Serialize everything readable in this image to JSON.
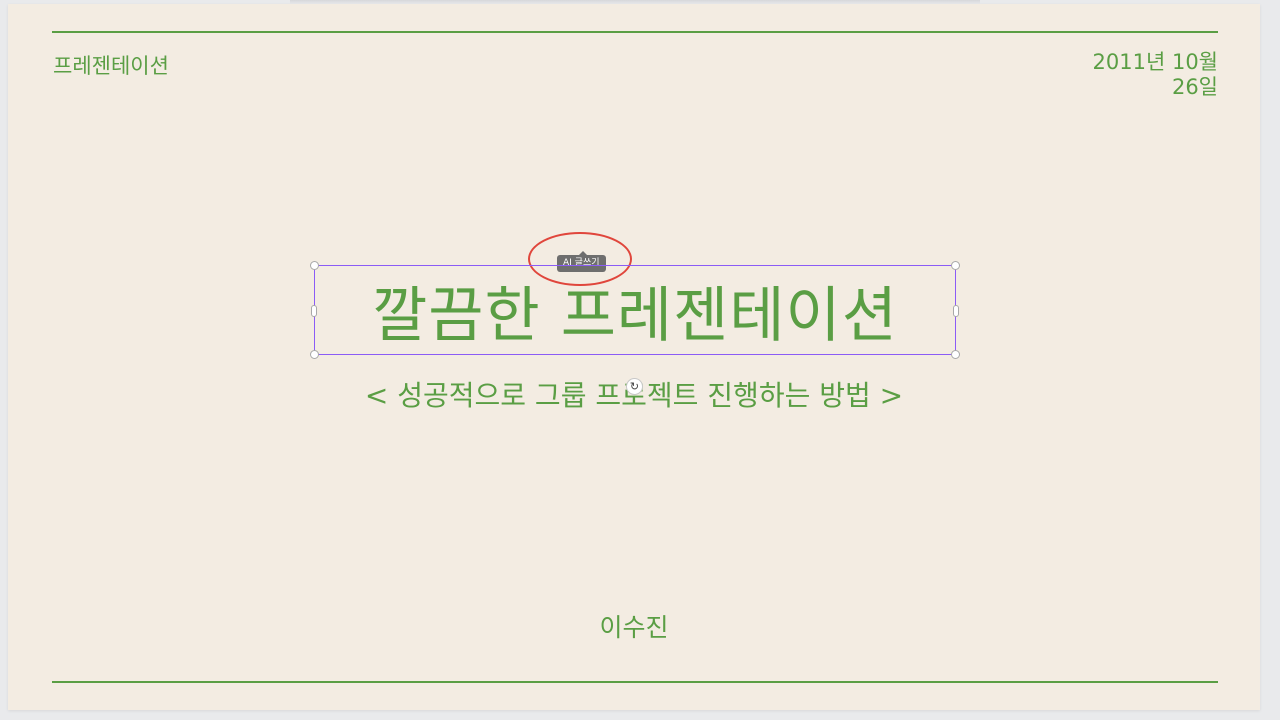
{
  "slide": {
    "header_left": "프레젠테이션",
    "date_line1": "2011년 10월",
    "date_line2": "26일",
    "title": "깔끔한 프레젠테이션",
    "subtitle": "< 성공적으로 그룹 프로젝트 진행하는 방법 >",
    "author": "이수진"
  },
  "toolbar": {
    "ai_write_label": "AI 글쓰기"
  },
  "icons": {
    "rotate_handle": "rotate-icon"
  },
  "colors": {
    "accent": "#5a9e44",
    "background": "#f3ece2",
    "selection": "#8b5cf6",
    "highlight": "#e0463c"
  }
}
